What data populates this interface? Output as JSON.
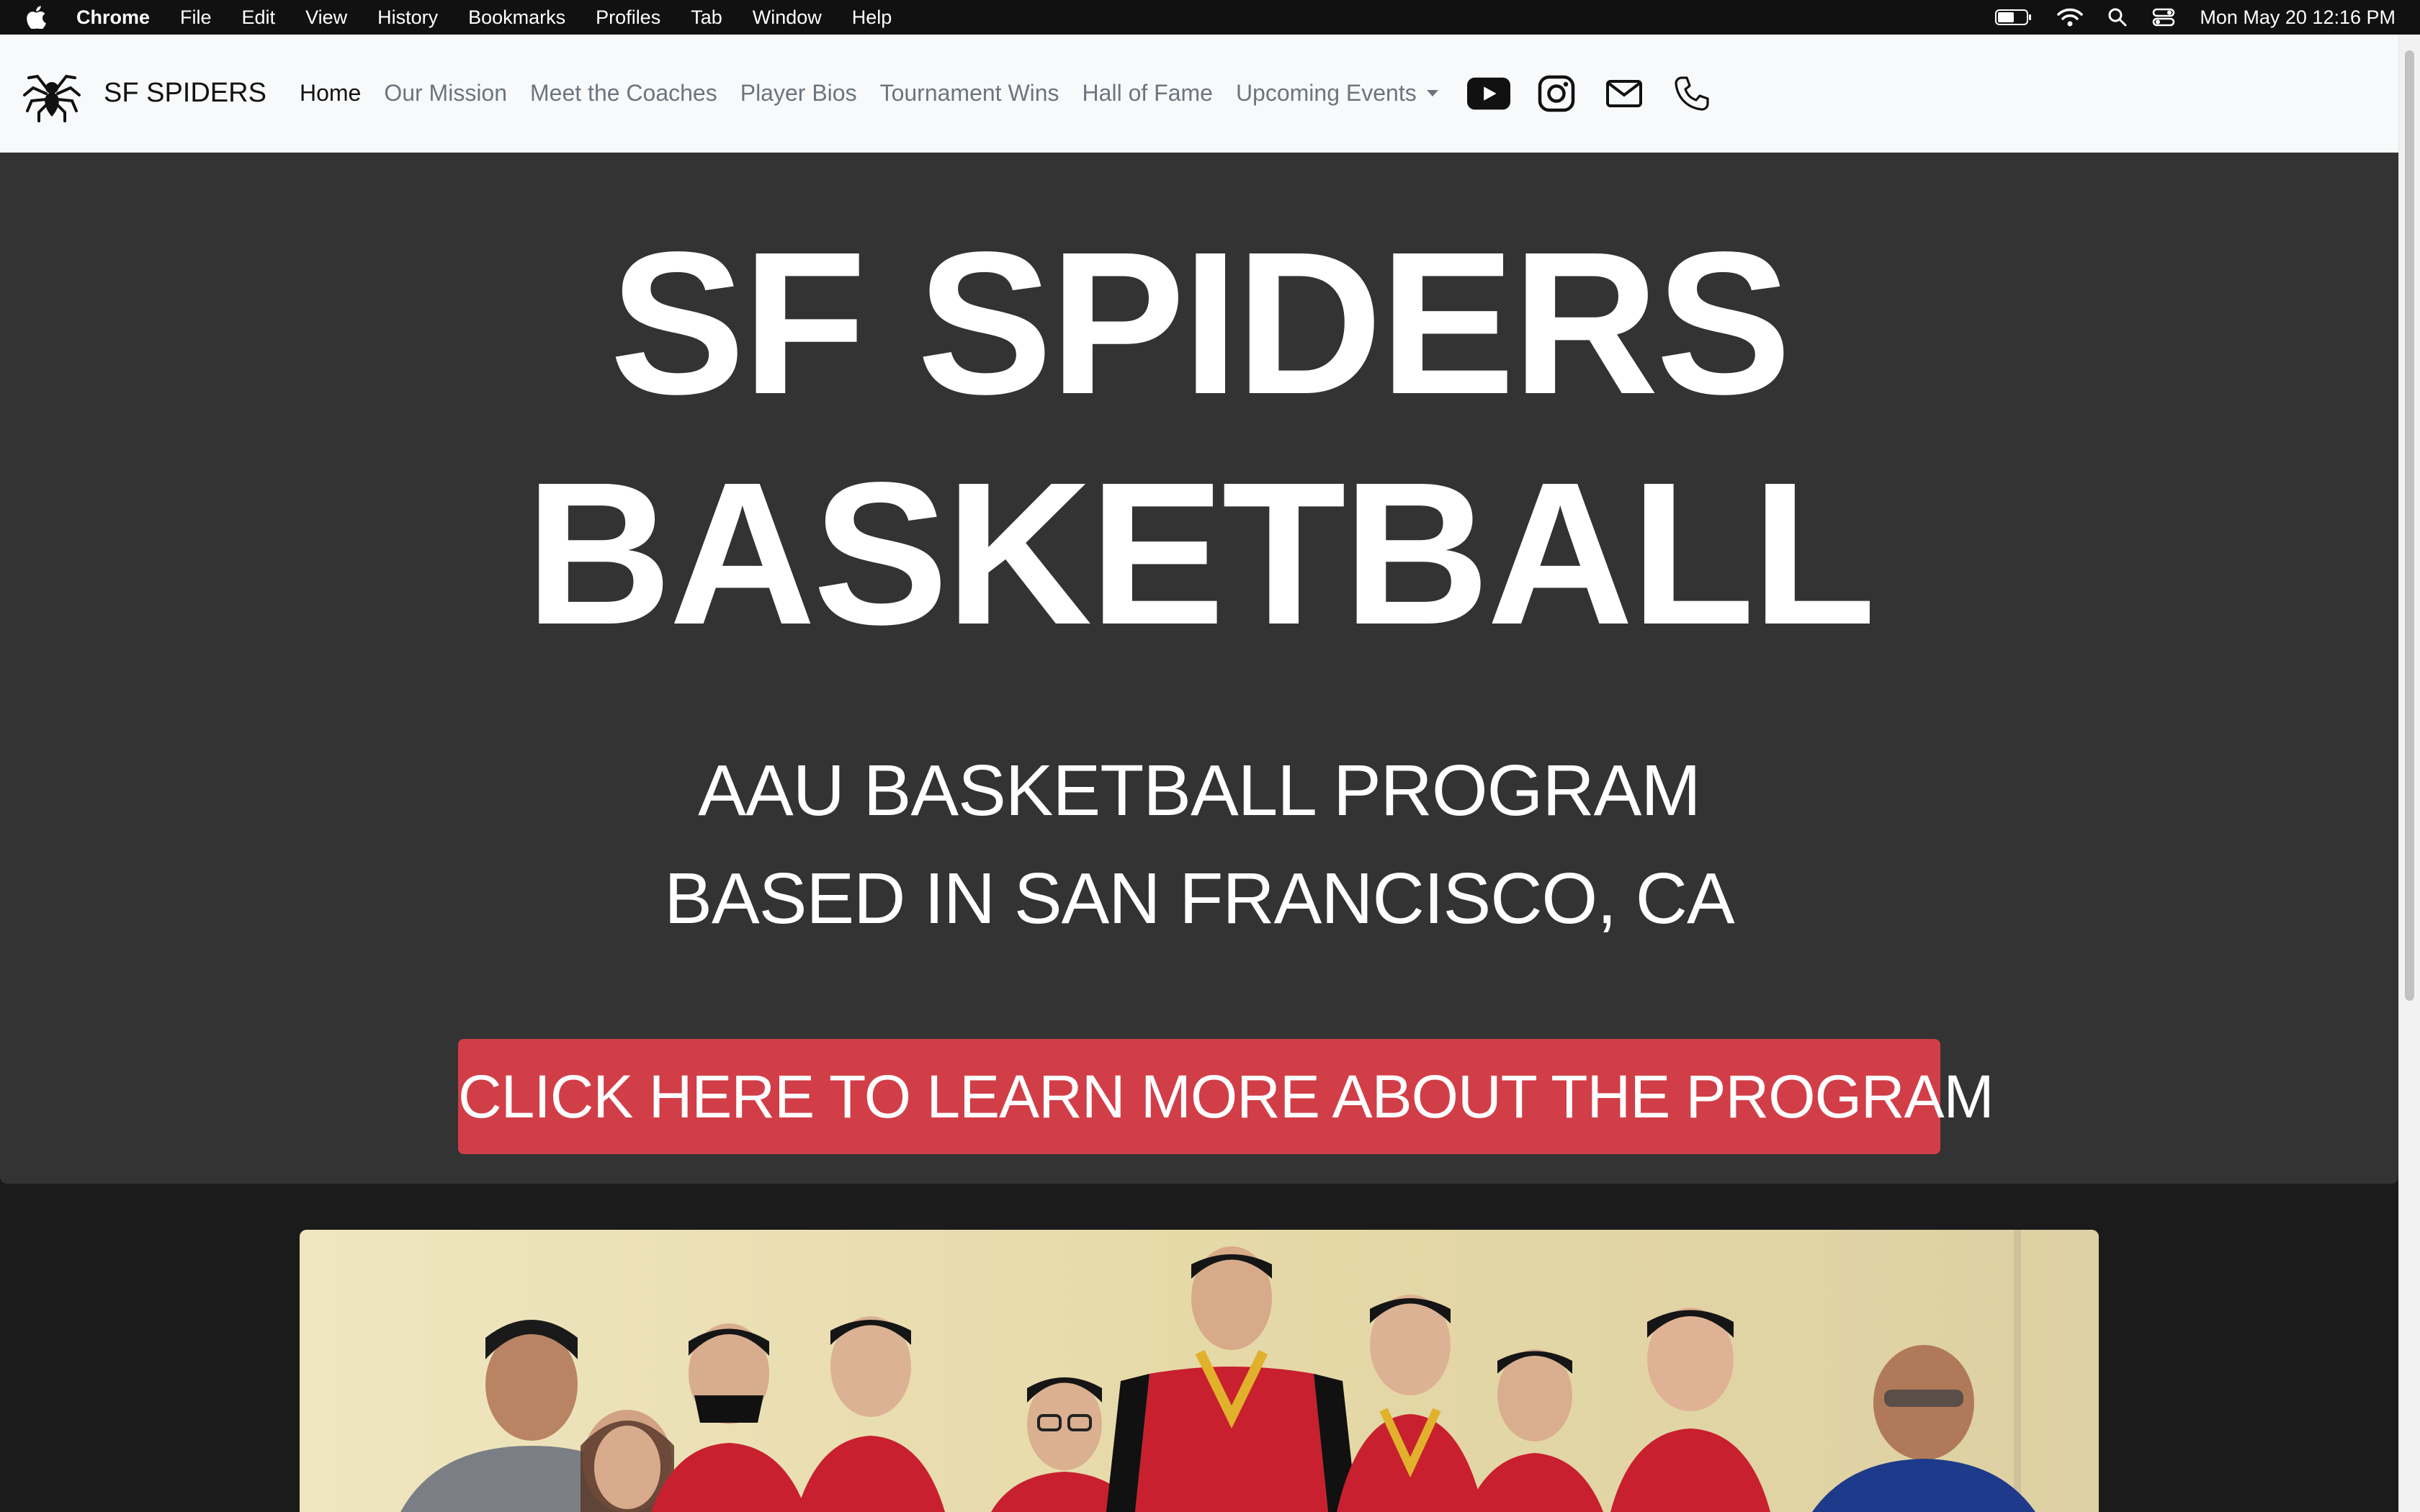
{
  "menubar": {
    "app_name": "Chrome",
    "items": [
      "File",
      "Edit",
      "View",
      "History",
      "Bookmarks",
      "Profiles",
      "Tab",
      "Window",
      "Help"
    ],
    "clock": "Mon May 20  12:16 PM"
  },
  "navbar": {
    "brand": "SF SPIDERS",
    "links": [
      {
        "label": "Home",
        "active": true
      },
      {
        "label": "Our Mission"
      },
      {
        "label": "Meet the Coaches"
      },
      {
        "label": "Player Bios"
      },
      {
        "label": "Tournament Wins"
      },
      {
        "label": "Hall of Fame"
      },
      {
        "label": "Upcoming Events",
        "dropdown": true
      }
    ],
    "social_icons": [
      "youtube-icon",
      "instagram-icon",
      "mail-icon",
      "phone-icon"
    ]
  },
  "hero": {
    "title_line1": "SF SPIDERS",
    "title_line2": "BASKETBALL",
    "subtitle_line1": "AAU BASKETBALL PROGRAM",
    "subtitle_line2": "BASED IN SAN FRANCISCO, CA",
    "cta_label": "CLICK HERE TO LEARN MORE ABOUT THE PROGRAM"
  },
  "colors": {
    "hero_bg": "#333333",
    "page_bg": "#1b1b1b",
    "cta_red": "#d13e47",
    "navbar_bg": "#f8f9fa"
  }
}
